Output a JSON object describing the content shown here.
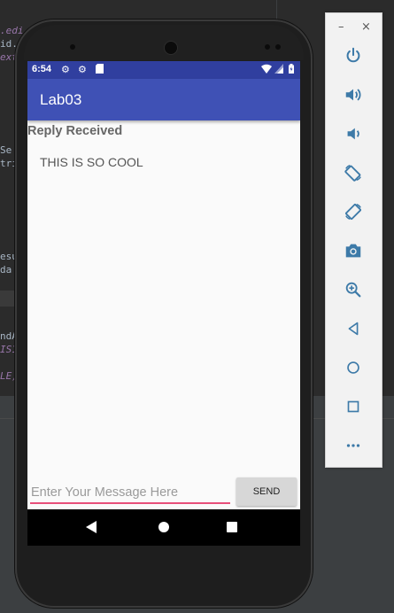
{
  "app": {
    "title": "Lab03",
    "status_time": "6:54"
  },
  "reply": {
    "heading": "Reply Received",
    "message": "THIS IS SO COOL"
  },
  "compose": {
    "placeholder": "Enter Your Message Here",
    "value": "",
    "send_label": "SEND"
  },
  "ide_snippets": [
    ".edi",
    "id.",
    "ext",
    "Se",
    "tri",
    "esu",
    "da",
    "ndA",
    "IS1",
    "LE)"
  ],
  "toolbar": {
    "minimize_label": "–",
    "close_label": "×",
    "icons": [
      "power-icon",
      "volume-up-icon",
      "volume-down-icon",
      "rotate-left-icon",
      "rotate-right-icon",
      "camera-icon",
      "zoom-icon",
      "back-icon",
      "home-icon",
      "overview-icon",
      "more-icon"
    ]
  },
  "colors": {
    "status_bar": "#303f9f",
    "app_bar": "#3f51b5",
    "input_underline": "#e84f7a",
    "toolbar_icon": "#3d7aa8"
  }
}
